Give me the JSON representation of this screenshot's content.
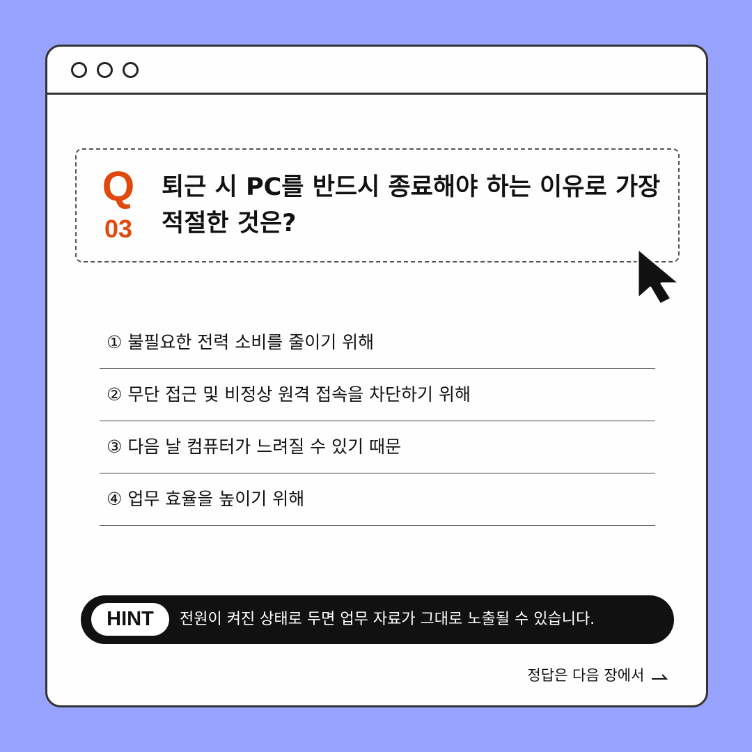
{
  "window": {
    "controls": [
      "circle-icon",
      "circle-icon",
      "circle-icon"
    ]
  },
  "question": {
    "letter": "Q",
    "number": "03",
    "text": "퇴근 시 PC를 반드시 종료해야 하는 이유로 가장 적절한 것은?"
  },
  "options": [
    "① 불필요한 전력 소비를 줄이기 위해",
    "② 무단 접근 및 비정상 원격 접속을 차단하기 위해",
    "③ 다음 날 컴퓨터가 느려질 수 있기 때문",
    "④ 업무 효율을 높이기 위해"
  ],
  "hint": {
    "label": "HINT",
    "text": "전원이 켜진 상태로 두면 업무 자료가 그대로 노출될 수 있습니다."
  },
  "footer": {
    "next_label": "정답은 다음 장에서",
    "icon": "arrow-right-icon"
  },
  "colors": {
    "background": "#98a2ff",
    "accent": "#e0480d",
    "window": "#fefefe",
    "hint_bar": "#111111"
  }
}
